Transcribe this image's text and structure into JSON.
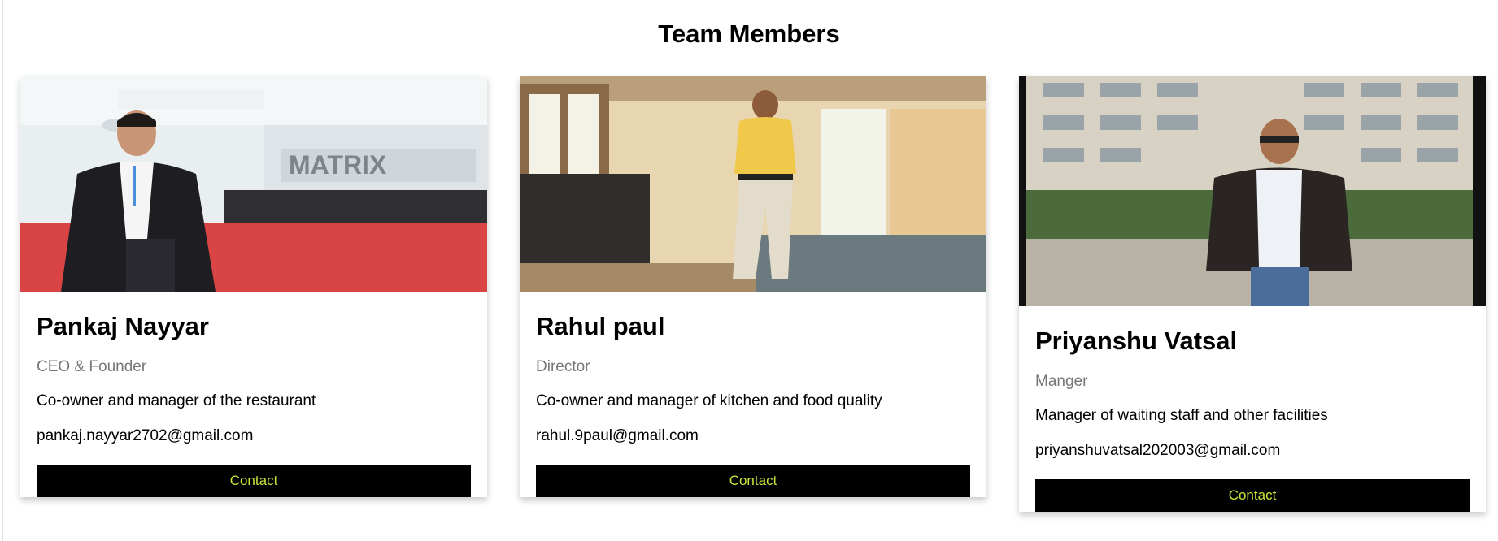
{
  "page": {
    "title": "Team Members"
  },
  "members": [
    {
      "name": "Pankaj Nayyar",
      "role": "CEO & Founder",
      "description": "Co-owner and manager of the restaurant",
      "email": "pankaj.nayyar2702@gmail.com",
      "button_label": "Contact",
      "photo_banner_text": "MATRIX"
    },
    {
      "name": "Rahul paul",
      "role": "Director",
      "description": "Co-owner and manager of kitchen and food quality",
      "email": "rahul.9paul@gmail.com",
      "button_label": "Contact"
    },
    {
      "name": "Priyanshu Vatsal",
      "role": "Manger",
      "description": "Manager of waiting staff and other facilities",
      "email": "priyanshuvatsal202003@gmail.com",
      "button_label": "Contact"
    }
  ],
  "colors": {
    "button_bg": "#000000",
    "button_text": "#c8e63c",
    "role_text": "#777777"
  }
}
